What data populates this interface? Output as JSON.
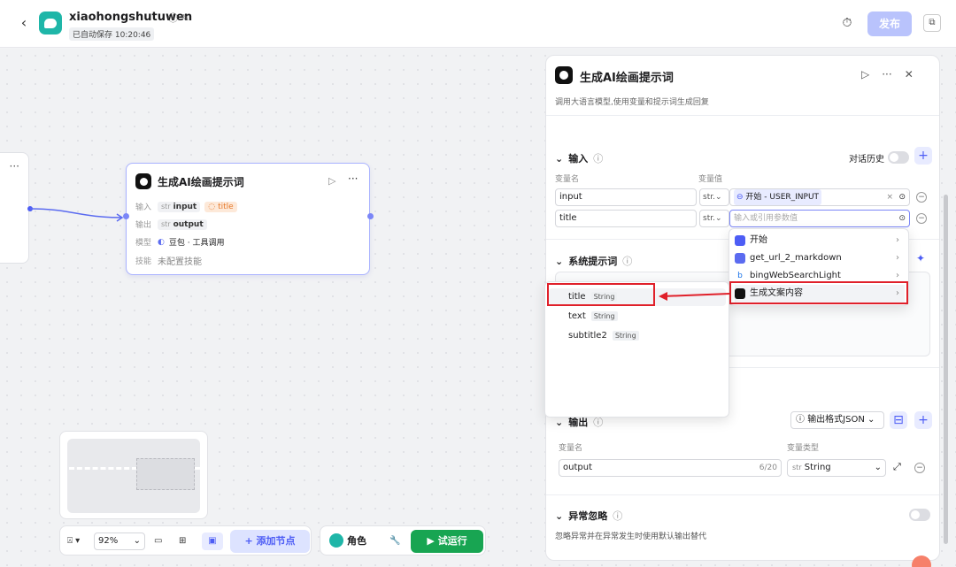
{
  "app": {
    "name": "xiaohongshutuwen",
    "save_status": "已自动保存 10:20:46",
    "publish": "发布"
  },
  "node": {
    "title": "生成AI绘画提示词",
    "input_label": "输入",
    "input_type": "str",
    "input_var": "input",
    "input_ref": "title",
    "output_label": "输出",
    "output_type": "str",
    "output_var": "output",
    "model_label": "模型",
    "model_value": "豆包 · 工具调用",
    "skill_label": "技能",
    "skill_value": "未配置技能"
  },
  "toolbar": {
    "zoom": "92%",
    "add_node": "添加节点",
    "role": "角色",
    "run": "试运行"
  },
  "panel": {
    "title": "生成AI绘画提示词",
    "description": "调用大语言模型,使用变量和提示词生成回复",
    "input_section": "输入",
    "chat_history": "对话历史",
    "col_name": "变量名",
    "col_value": "变量值",
    "rows": [
      {
        "name": "input",
        "type": "str.",
        "ref": "开始 - USER_INPUT"
      },
      {
        "name": "title",
        "type": "str.",
        "placeholder": "输入或引用参数值"
      }
    ],
    "system_prompt": "系统提示词",
    "output_section": "输出",
    "output_format": "输出格式JSON",
    "out_col_name": "变量名",
    "out_col_type": "变量类型",
    "output_var": "output",
    "output_count": "6/20",
    "output_type": "String",
    "exception_title": "异常忽略",
    "exception_desc": "忽略异常并在异常发生时使用默认输出替代"
  },
  "dropdown_nodes": [
    {
      "label": "开始",
      "color": "#4d5df5"
    },
    {
      "label": "get_url_2_markdown",
      "color": "#5b6bf0"
    },
    {
      "label": "bingWebSearchLight",
      "color": "#1a73e8"
    },
    {
      "label": "生成文案内容",
      "color": "#111111"
    }
  ],
  "dropdown_vars": [
    {
      "name": "title",
      "type": "String"
    },
    {
      "name": "text",
      "type": "String"
    },
    {
      "name": "subtitle2",
      "type": "String"
    }
  ]
}
